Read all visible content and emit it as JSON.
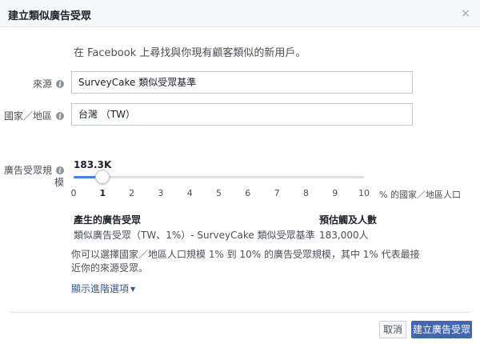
{
  "dialog": {
    "title": "建立類似廣告受眾",
    "close_glyph": "×"
  },
  "intro": "在 Facebook 上尋找與你現有顧客類似的新用戶。",
  "source": {
    "label": "來源",
    "value": "SurveyCake 類似受眾基準"
  },
  "country": {
    "label": "國家／地區",
    "value": "台灣 （TW）"
  },
  "audience_size": {
    "label_line1": "廣告受眾規",
    "label_line2": "模",
    "value_display": "183.3K",
    "selected": 1,
    "min": 0,
    "max": 10,
    "ticks": [
      "0",
      "1",
      "2",
      "3",
      "4",
      "5",
      "6",
      "7",
      "8",
      "9",
      "10"
    ],
    "unit": "% 的國家／地區人口"
  },
  "summary": {
    "audience_header": "產生的廣告受眾",
    "audience_value": "類似廣告受眾（TW、1%）- SurveyCake 類似受眾基準",
    "reach_header": "預估觸及人數",
    "reach_value": "183,000人"
  },
  "help_text": "你可以選擇國家／地區人口規模 1% 到 10% 的廣告受眾規模，其中 1% 代表最接近你的來源受眾。",
  "advanced_link": "顯示進階選項",
  "buttons": {
    "cancel": "取消",
    "create": "建立廣告受眾"
  },
  "colors": {
    "primary_button": "#4267b2",
    "link": "#365899",
    "slider_fill": "#4080ff"
  }
}
